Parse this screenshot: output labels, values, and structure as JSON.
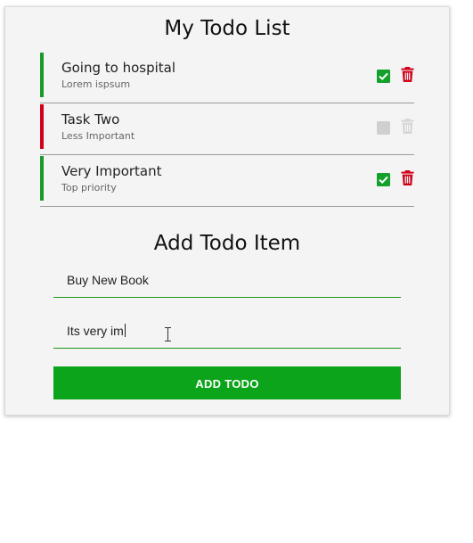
{
  "header": {
    "title": "My Todo List"
  },
  "todos": [
    {
      "title": "Going to hospital",
      "subtitle": "Lorem ispsum",
      "priority_color": "#1a9a2a",
      "completed": true,
      "check_color": "#13a12b",
      "trash_color": "#d0021b"
    },
    {
      "title": "Task Two",
      "subtitle": "Less Important",
      "priority_color": "#d0021b",
      "completed": false,
      "check_color": "#cfcfcf",
      "trash_color": "#d6d6d6"
    },
    {
      "title": "Very Important",
      "subtitle": "Top priority",
      "priority_color": "#1a9a2a",
      "completed": true,
      "check_color": "#13a12b",
      "trash_color": "#d0021b"
    }
  ],
  "icons": {
    "check": "checkbox-icon",
    "trash": "trash-icon",
    "cursor": "text-cursor-icon"
  },
  "form": {
    "heading": "Add Todo Item",
    "title_value": "Buy New Book",
    "description_value": "Its very im",
    "button_label": "ADD TODO",
    "accent_color": "#0ba41a"
  }
}
